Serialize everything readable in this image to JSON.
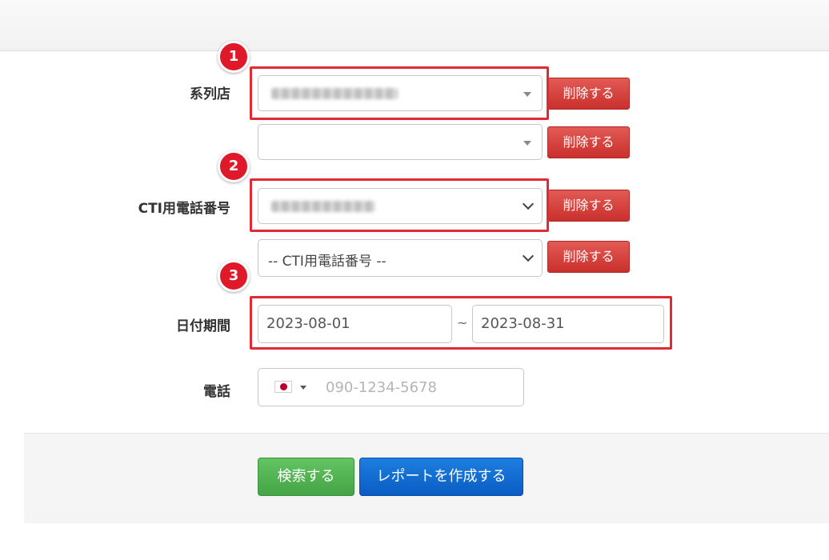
{
  "form": {
    "store_label": "系列店",
    "cti_label": "CTI用電話番号",
    "date_label": "日付期間",
    "phone_label": "電話",
    "delete_label": "削除する",
    "cti_placeholder": "-- CTI用電話番号 --",
    "date_from": "2023-08-01",
    "date_to": "2023-08-31",
    "date_separator": "~",
    "phone_placeholder": "090-1234-5678",
    "phone_flag_icon": "japan-flag-icon"
  },
  "callouts": [
    "1",
    "2",
    "3"
  ],
  "actions": {
    "search_label": "検索する",
    "report_label": "レポートを作成する"
  },
  "colors": {
    "delete_button": "#d9534f",
    "search_button": "#51b351",
    "report_button": "#0d6ed8",
    "callout": "#e0192a"
  }
}
